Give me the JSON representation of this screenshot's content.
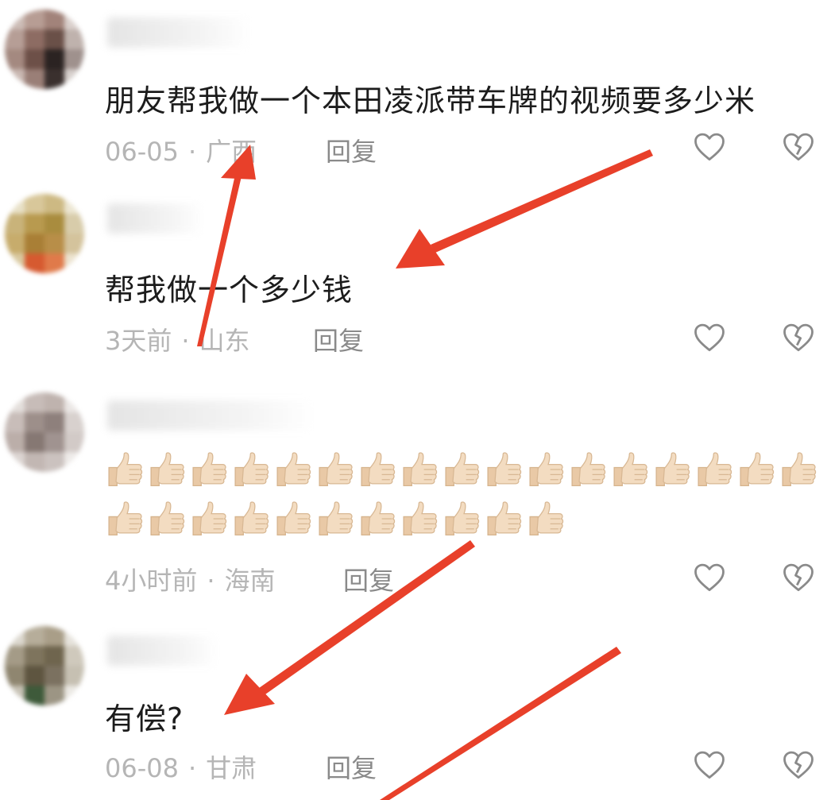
{
  "comments": [
    {
      "text": "朋友帮我做一个本田凌派带车牌的视频要多少米",
      "time": "06-05",
      "location": "广西",
      "reply_label": "回复",
      "like_icon": "heart-outline-icon",
      "dislike_icon": "broken-heart-icon"
    },
    {
      "text": "帮我做一个多少钱",
      "time": "3天前",
      "location": "山东",
      "reply_label": "回复",
      "like_icon": "heart-outline-icon",
      "dislike_icon": "broken-heart-icon"
    },
    {
      "text": "",
      "emoji": "thumbs-up",
      "emoji_count_row1": 17,
      "emoji_count_row2": 11,
      "time": "4小时前",
      "location": "海南",
      "reply_label": "回复",
      "like_icon": "heart-outline-icon",
      "dislike_icon": "broken-heart-icon"
    },
    {
      "text": "有偿?",
      "time": "06-08",
      "location": "甘肃",
      "reply_label": "回复",
      "like_icon": "heart-outline-icon",
      "dislike_icon": "broken-heart-icon"
    }
  ],
  "colors": {
    "arrow": "#e8402a",
    "meta_text": "#b5b5b5",
    "reply_text": "#8a8a8a",
    "body_text": "#1c1c1c"
  }
}
